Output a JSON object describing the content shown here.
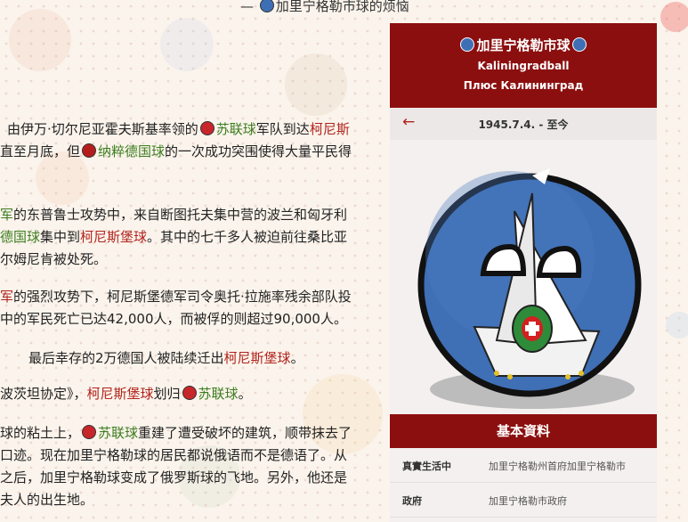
{
  "header": {
    "dash": "—",
    "title_after_icon": "加里宁格勒市球的烦恼"
  },
  "article": {
    "p1": {
      "l1_a": "由伊万·切尔尼亚霍夫斯基率领的",
      "l1_link1": "苏联球",
      "l1_b": "军队到达",
      "l1_link2": "柯尼斯",
      "l2_a": "直至月底，但",
      "l2_link": "纳粹德国球",
      "l2_b": "的一次成功突围使得大量平民得"
    },
    "p2": {
      "l1_link": "军",
      "l1_b": "的东普鲁士攻势中，来自断图托夫集中营的波兰和匈牙利",
      "l2_link1": "德国球",
      "l2_b": "集中到",
      "l2_link2": "柯尼斯堡球",
      "l2_c": "。其中的七千多人被迫前往桑比亚",
      "l3": "尔姆尼肯被处死。"
    },
    "p3": {
      "l1_link": "军",
      "l1_b": "的强烈攻势下，柯尼斯堡德军司令奥托·拉施率残余部队投",
      "l2": "中的军民死亡已达42,000人，而被俘的则超过90,000人。"
    },
    "p4": {
      "l1_a": "最后幸存的2万德国人被陆续迁出",
      "l1_link": "柯尼斯堡球",
      "l1_b": "。"
    },
    "p5": {
      "l1_a": "波茨坦协定》，",
      "l1_link1": "柯尼斯堡球",
      "l1_b": "划归",
      "l1_link2": "苏联球",
      "l1_c": "。"
    },
    "p6": {
      "l1_a": "球的粘土上，",
      "l1_link": "苏联球",
      "l1_b": "重建了遭受破坏的建筑，顺带抹去了",
      "l2": "口迹。现在加里宁格勒球的居民都说俄语而不是德语了。从",
      "l3": "之后，加里宁格勒球变成了俄罗斯球的飞地。另外，他还是",
      "l4": "夫人的出生地。"
    }
  },
  "infobox": {
    "title": "加里宁格勒市球",
    "subtitle_latin": "Kaliningradball",
    "subtitle_cyrillic": "Плюс Калининград",
    "prev_arrow": "←",
    "date": "1945.7.4. - 至今",
    "section_title": "基本資料",
    "rows": [
      {
        "key": "真實生活中",
        "value": "加里宁格勒州首府加里宁格勒市"
      },
      {
        "key": "政府",
        "value": "加里宁格勒市政府"
      }
    ]
  },
  "colors": {
    "accent_dark_red": "#8c0f0f",
    "link_red": "#b1221b",
    "link_green": "#3c7d1e",
    "ball_blue": "#3e6fb5"
  }
}
